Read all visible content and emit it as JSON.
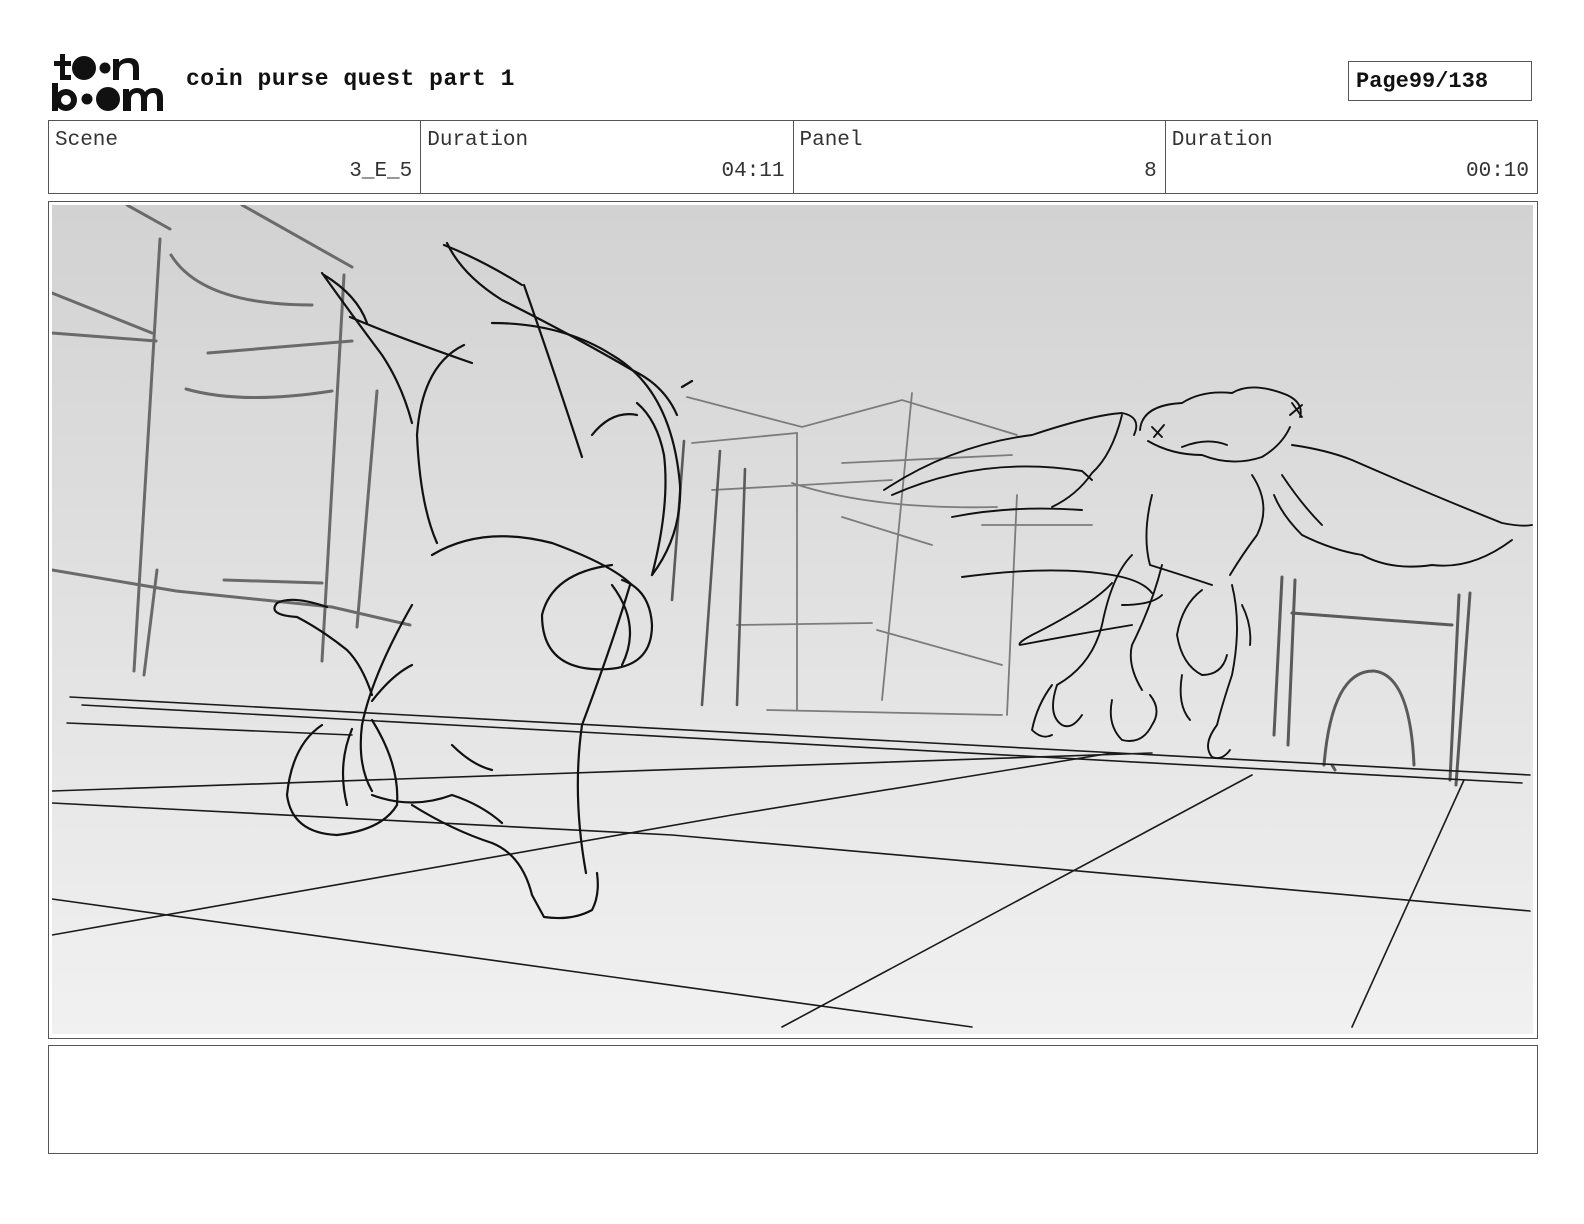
{
  "header": {
    "logo_text_top": "toon",
    "logo_text_bottom": "boom",
    "title": "coin purse quest part 1",
    "page_label": "Page",
    "page_number": "99/138"
  },
  "info": {
    "scene_label": "Scene",
    "scene_value": "3_E_5",
    "duration_label": "Duration",
    "duration_value": "04:11",
    "panel_label": "Panel",
    "panel_value": "8",
    "panel_duration_label": "Duration",
    "panel_duration_value": "00:10"
  },
  "panel": {
    "sky_color": "#d2d2d2",
    "floor_color": "#f1f1f1"
  },
  "notes": {
    "text": ""
  }
}
